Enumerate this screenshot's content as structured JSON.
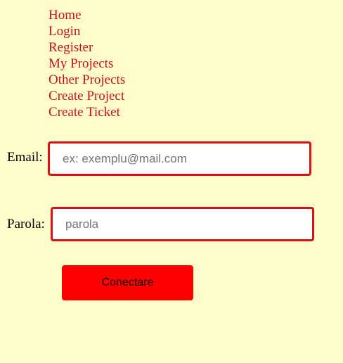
{
  "nav": {
    "items": [
      {
        "label": "Home"
      },
      {
        "label": "Login"
      },
      {
        "label": "Register"
      },
      {
        "label": "My Projects"
      },
      {
        "label": "Other Projects"
      },
      {
        "label": "Create Project"
      },
      {
        "label": "Create Ticket"
      }
    ]
  },
  "form": {
    "email": {
      "label": "Email:",
      "placeholder": "ex: exemplu@mail.com",
      "value": ""
    },
    "password": {
      "label": "Parola:",
      "placeholder": "parola",
      "value": ""
    },
    "submit_label": "Conectare"
  },
  "colors": {
    "background": "#fffccc",
    "link": "#cc1111",
    "input_border": "#dd1111",
    "button": "#ff0000"
  }
}
